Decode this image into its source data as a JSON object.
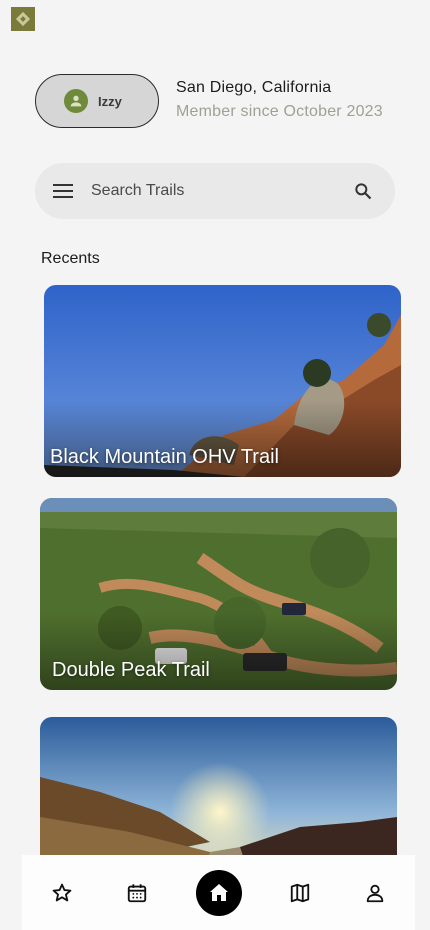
{
  "app": {
    "logo_icon": "app-logo-icon"
  },
  "profile": {
    "name": "Izzy",
    "location": "San Diego, California",
    "member_since": "Member since October 2023",
    "avatar_color": "#6e8a3a"
  },
  "search": {
    "placeholder": "Search Trails"
  },
  "recents": {
    "title": "Recents",
    "cards": [
      {
        "title": "Black Mountain OHV Trail"
      },
      {
        "title": "Double Peak Trail"
      },
      {
        "title": ""
      }
    ]
  },
  "nav": {
    "items": [
      "favorites-icon",
      "calendar-icon",
      "home-icon",
      "map-icon",
      "profile-icon"
    ],
    "active": "home-icon"
  }
}
